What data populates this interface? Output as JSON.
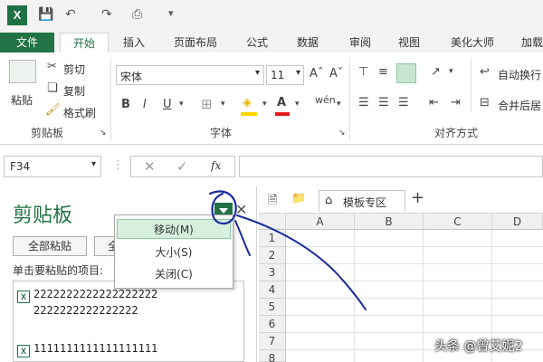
{
  "app": {
    "logo_letter": "X"
  },
  "tabs": [
    "文件",
    "开始",
    "插入",
    "页面布局",
    "公式",
    "数据",
    "审阅",
    "视图",
    "美化大师",
    "加载"
  ],
  "clipboard_group": {
    "paste": "粘贴",
    "cut": "剪切",
    "copy": "复制",
    "format_painter": "格式刷",
    "label": "剪贴板"
  },
  "font_group": {
    "font_name": "宋体",
    "font_size": "11",
    "label": "字体",
    "bold": "B",
    "italic": "I",
    "underline": "U",
    "font_color_letter": "A"
  },
  "alignment_group": {
    "wrap_text": "自动换行",
    "merge_center": "合并后居",
    "label": "对齐方式"
  },
  "formula_bar": {
    "name_box": "F34",
    "fx": "fx"
  },
  "pane": {
    "title": "剪贴板",
    "paste_all": "全部粘贴",
    "clear_all_partial": "全",
    "hint": "单击要粘贴的项目:",
    "items": [
      {
        "line1": "2222222222222222222",
        "line2": "2222222222222222"
      },
      {
        "line1": "1111111111111111111",
        "line2": ""
      }
    ]
  },
  "menu": {
    "items": [
      "移动(M)",
      "大小(S)",
      "关闭(C)"
    ],
    "selected_index": 0
  },
  "sheet": {
    "template_tab": "模板专区",
    "columns": [
      "A",
      "B",
      "C",
      "D"
    ],
    "rows": [
      "1",
      "2",
      "3",
      "4",
      "5",
      "6",
      "7",
      "8"
    ]
  },
  "watermark": "头条 @曾艾妮2",
  "colors": {
    "accent": "#217346",
    "annotation": "#1b2c9c"
  }
}
